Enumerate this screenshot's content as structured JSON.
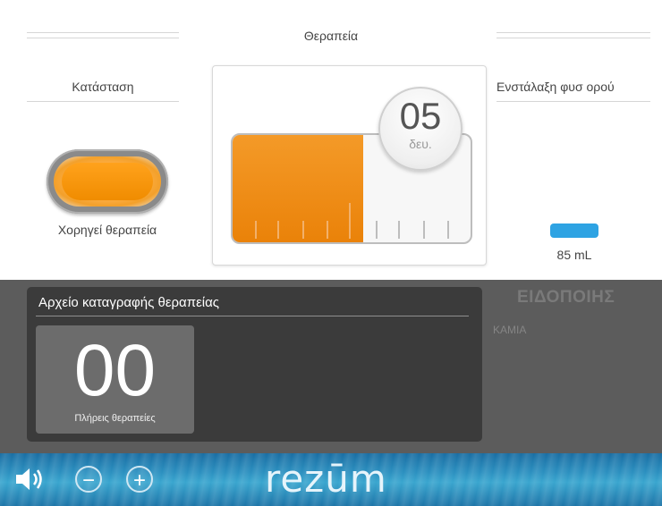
{
  "header": {
    "title": "Θεραπεία"
  },
  "status": {
    "label": "Κατάσταση",
    "state_text": "Χορηγεί θεραπεία",
    "lamp_color": "#F39314"
  },
  "saline": {
    "label": "Ενστάλαξη φυσ ορού",
    "value": "85 mL",
    "indicator_color": "#2EA3E3"
  },
  "timer": {
    "value": "05",
    "unit": "δευ.",
    "progress_fraction": 0.55
  },
  "log": {
    "title": "Αρχείο καταγραφής θεραπείας",
    "count": "00",
    "count_caption": "Πλήρεις θεραπείες"
  },
  "notifications": {
    "title": "ΕΙΔΟΠΟΙΗΣ",
    "value": "ΚΑΜΙΑ"
  },
  "footer": {
    "brand": "rezūm",
    "volume_icon": "speaker-icon",
    "minus_label": "−",
    "plus_label": "+"
  },
  "colors": {
    "accent_orange": "#F08C00",
    "saline_blue": "#2EA3E3",
    "footer_water": "#2B8FBF"
  }
}
